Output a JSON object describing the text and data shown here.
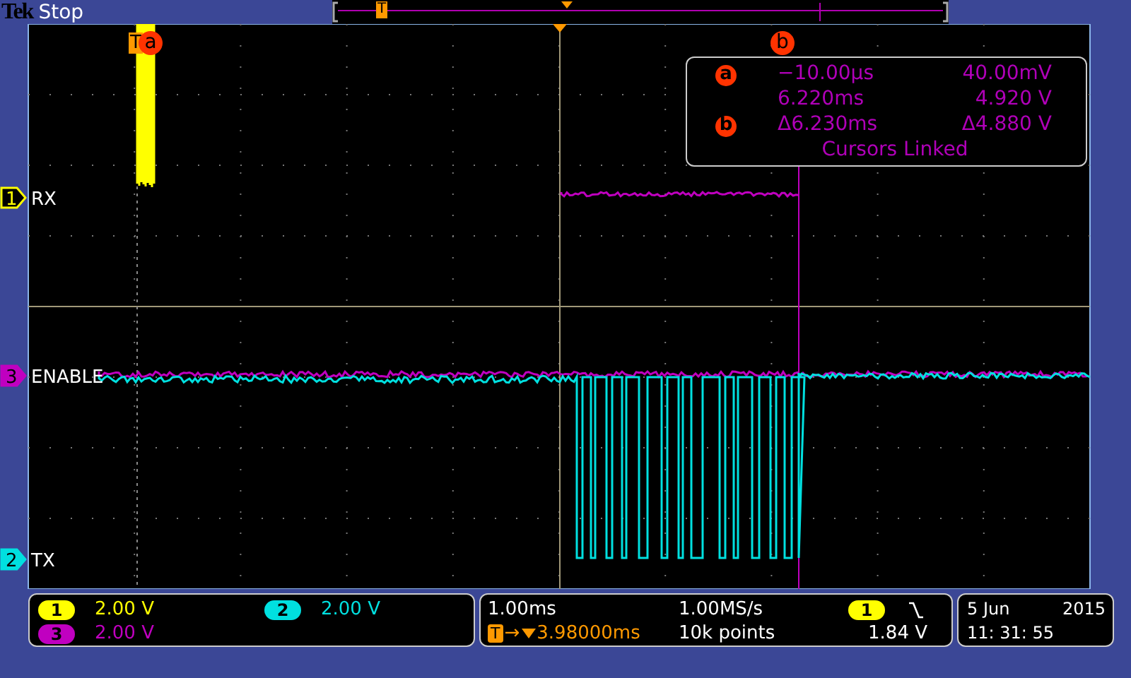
{
  "header": {
    "brand": "Tek",
    "status": "Stop",
    "record_trigger_mark": "T"
  },
  "plot": {
    "trigger_mark": "T",
    "cursor_labels": [
      "a",
      "b"
    ],
    "channels": [
      {
        "number": "1",
        "label": "RX",
        "color": "#ffff00"
      },
      {
        "number": "3",
        "label": "ENABLE",
        "color": "#c000c0"
      },
      {
        "number": "2",
        "label": "TX",
        "color": "#00e0e0"
      }
    ]
  },
  "cursor_readout": {
    "rows": [
      {
        "marker": "a",
        "time": "−10.00µs",
        "value": "40.00mV"
      },
      {
        "time": "6.220ms",
        "value": "4.920 V"
      },
      {
        "marker": "b",
        "time": "Δ6.230ms",
        "value": "Δ4.880 V"
      }
    ],
    "note": "Cursors Linked"
  },
  "vertical": [
    {
      "channel": "1",
      "scale": "2.00 V",
      "color": "#ffff00"
    },
    {
      "channel": "2",
      "scale": "2.00 V",
      "color": "#00e0e0"
    },
    {
      "channel": "3",
      "scale": "2.00 V",
      "color": "#c000c0"
    }
  ],
  "horizontal": {
    "scale": "1.00ms",
    "sample_rate": "1.00MS/s",
    "trigger_mark": "T",
    "arrow": "→",
    "delay": "3.98000ms",
    "record_length": "10k points"
  },
  "trigger": {
    "source": "1",
    "level": "1.84 V",
    "color": "#ffff00"
  },
  "clock": {
    "day": "5 Jun",
    "year": "2015",
    "time": "11: 31: 55"
  }
}
